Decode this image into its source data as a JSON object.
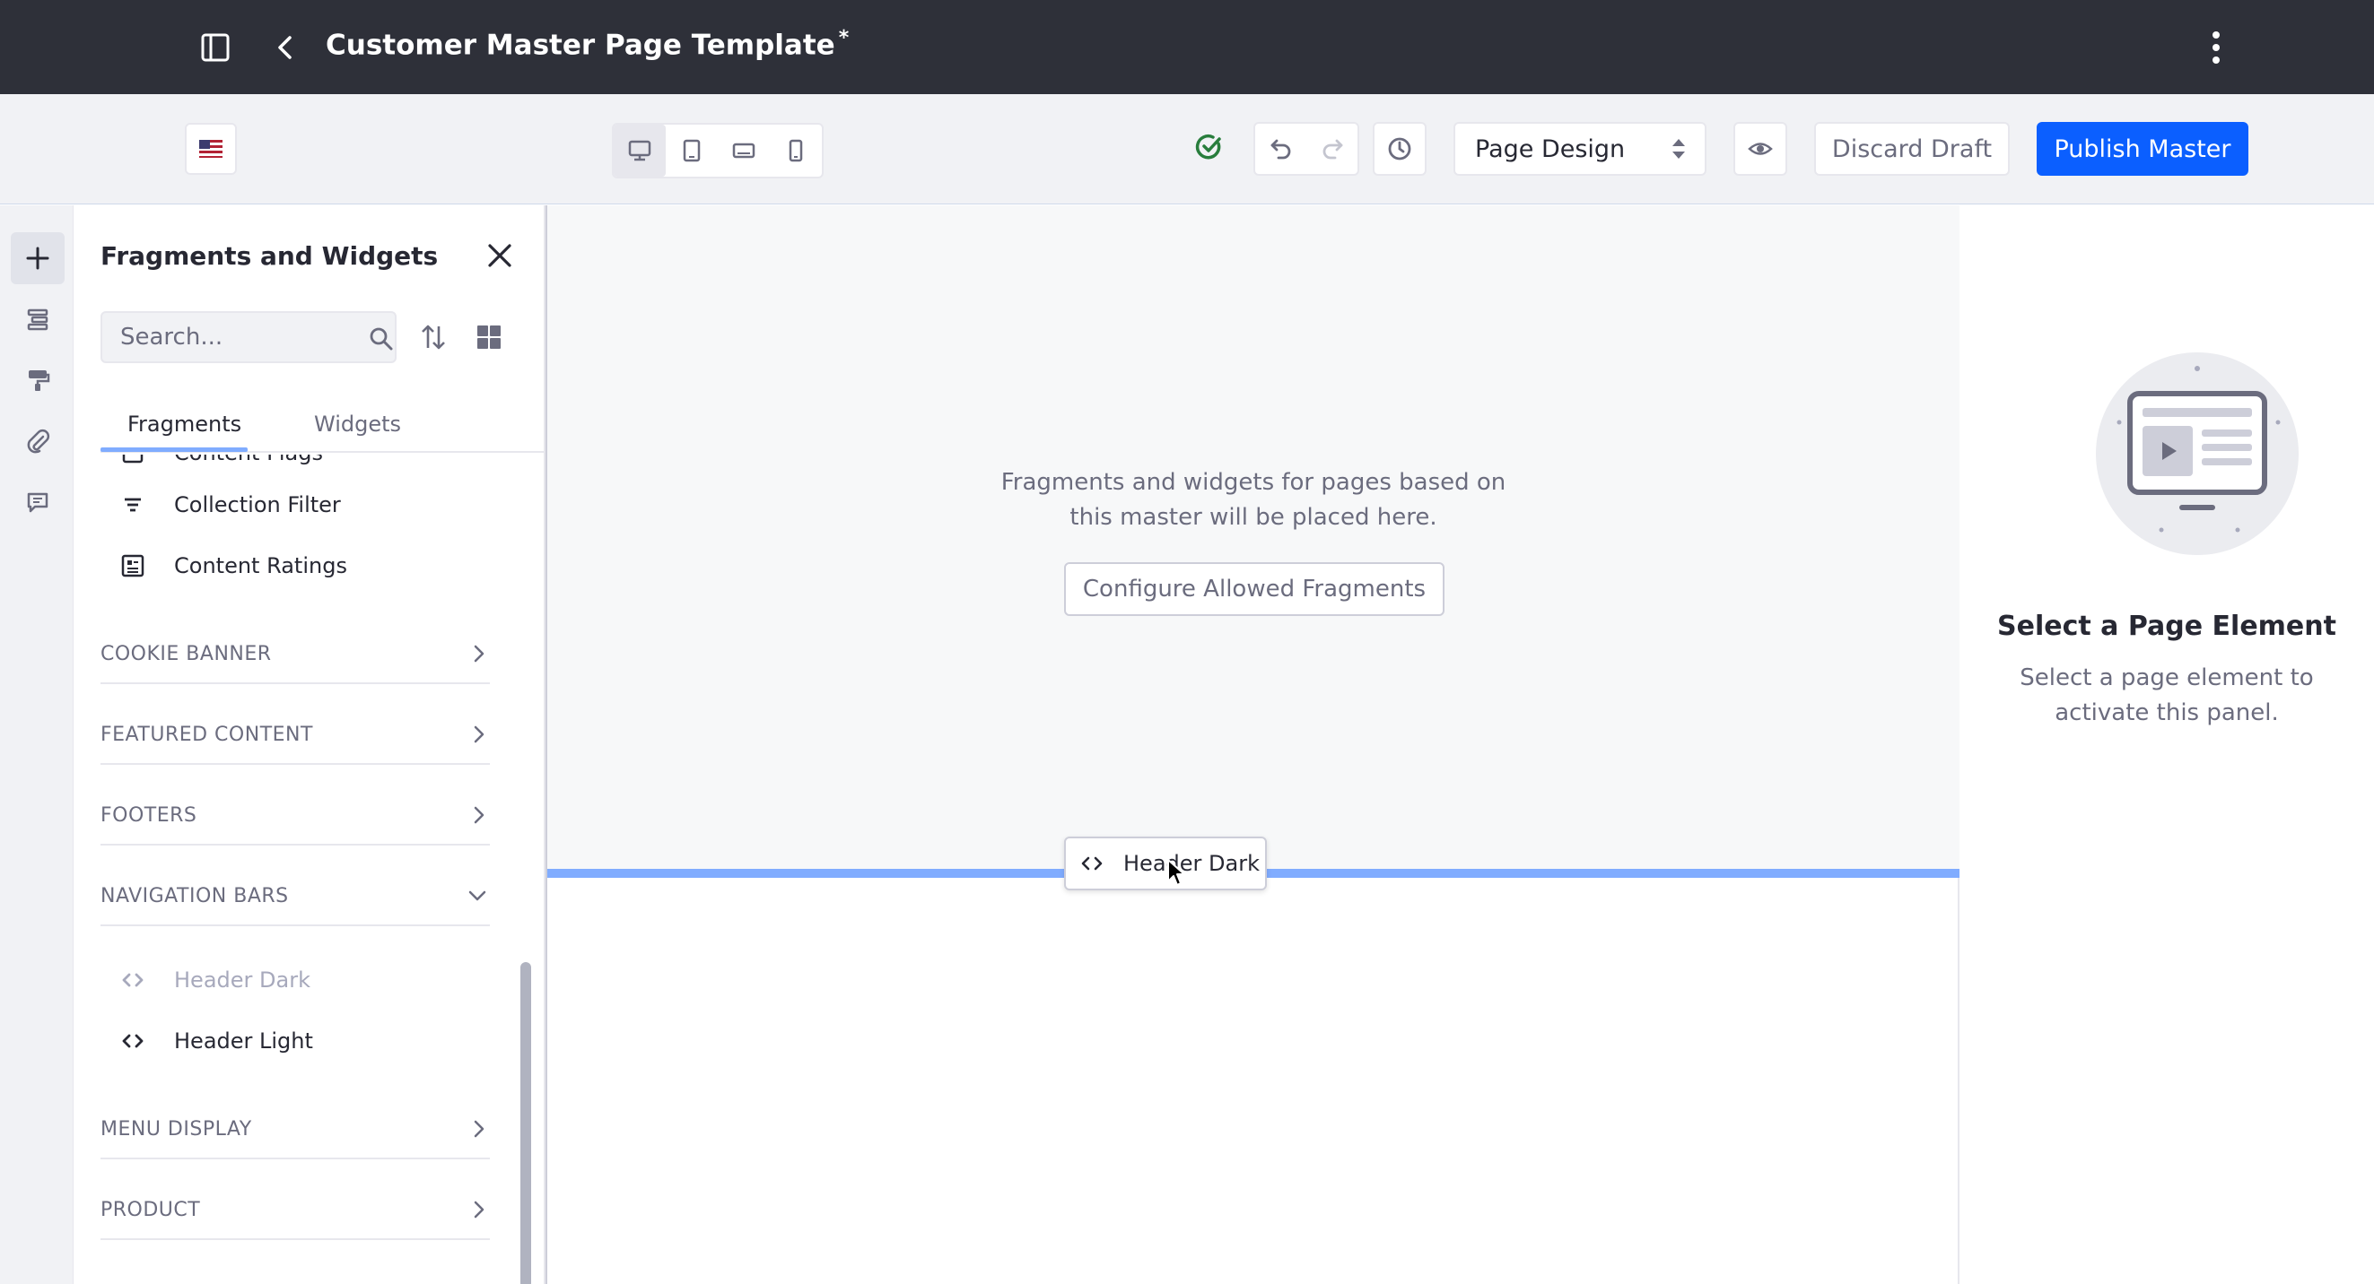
{
  "header": {
    "title": "Customer Master Page Template",
    "unsaved_marker": "*"
  },
  "toolbar": {
    "language_flag": "en-US",
    "viewports": [
      "desktop",
      "tablet",
      "landscape-phone",
      "portrait-phone"
    ],
    "mode_select": "Page Design",
    "discard_label": "Discard Draft",
    "publish_label": "Publish Master",
    "accent_color": "#0b5fff"
  },
  "rail": {
    "items": [
      "add-icon",
      "page-structure-icon",
      "page-design-icon",
      "mapped-contents-icon",
      "comments-icon"
    ]
  },
  "panel": {
    "title": "Fragments and Widgets",
    "search_placeholder": "Search...",
    "tabs": [
      "Fragments",
      "Widgets"
    ],
    "active_tab": "Fragments",
    "fragments_top": [
      {
        "label": "Content Flags"
      },
      {
        "label": "Collection Filter"
      },
      {
        "label": "Content Ratings"
      }
    ],
    "categories": [
      {
        "label": "COOKIE BANNER",
        "expanded": false
      },
      {
        "label": "FEATURED CONTENT",
        "expanded": false
      },
      {
        "label": "FOOTERS",
        "expanded": false
      },
      {
        "label": "NAVIGATION BARS",
        "expanded": true
      },
      {
        "label": "MENU DISPLAY",
        "expanded": false
      },
      {
        "label": "PRODUCT",
        "expanded": false
      }
    ],
    "navigation_bars_items": [
      {
        "label": "Header Dark",
        "dragging": true
      },
      {
        "label": "Header Light",
        "dragging": false
      }
    ]
  },
  "canvas": {
    "dropzone_line1": "Fragments and widgets for pages based on",
    "dropzone_line2": "this master will be placed here.",
    "configure_label": "Configure Allowed Fragments",
    "drag_item_label": "Header Dark"
  },
  "sidebar_right": {
    "title": "Select a Page Element",
    "desc_line1": "Select a page element to",
    "desc_line2": "activate this panel."
  }
}
